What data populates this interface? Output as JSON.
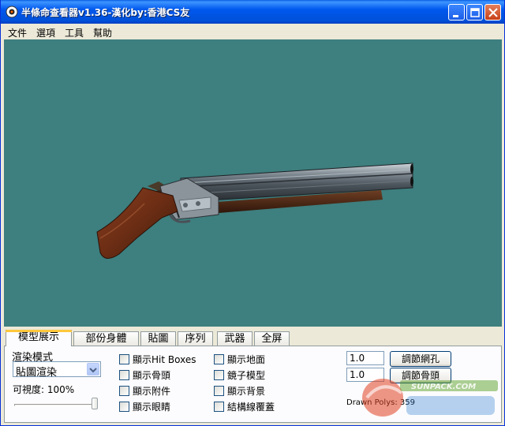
{
  "window": {
    "title": "半條命查看器v1.36-漢化by:香港CS友"
  },
  "menu": [
    "文件",
    "選項",
    "工具",
    "幫助"
  ],
  "tabs": [
    {
      "label": "模型展示",
      "active": true
    },
    {
      "label": "部份身體",
      "active": false
    },
    {
      "label": "貼圖",
      "active": false
    },
    {
      "label": "序列",
      "active": false
    },
    {
      "label": "武器",
      "active": false
    },
    {
      "label": "全屏",
      "active": false
    }
  ],
  "render": {
    "label": "渲染模式",
    "mode_value": "貼圖渲染",
    "visibility_label": "可視度: 100%",
    "visibility": 1.0
  },
  "checkboxes_col1": [
    {
      "label": "顯示Hit Boxes",
      "checked": false
    },
    {
      "label": "顯示骨頭",
      "checked": false
    },
    {
      "label": "顯示附件",
      "checked": false
    },
    {
      "label": "顯示眼睛",
      "checked": false
    }
  ],
  "checkboxes_col2": [
    {
      "label": "顯示地面",
      "checked": false
    },
    {
      "label": "鏡子模型",
      "checked": false
    },
    {
      "label": "顯示背景",
      "checked": false
    },
    {
      "label": "結構線覆蓋",
      "checked": false
    }
  ],
  "adjust": {
    "value1": "1.0",
    "button1": "調節網孔",
    "value2": "1.0",
    "button2": "調節骨頭"
  },
  "stats": {
    "drawn_polys": "Drawn Polys: 359"
  },
  "colors": {
    "viewport_bg": "#3e7f7f",
    "titlebar": "#0058ee"
  },
  "watermark": {
    "text": "SUNPACK.COM"
  }
}
